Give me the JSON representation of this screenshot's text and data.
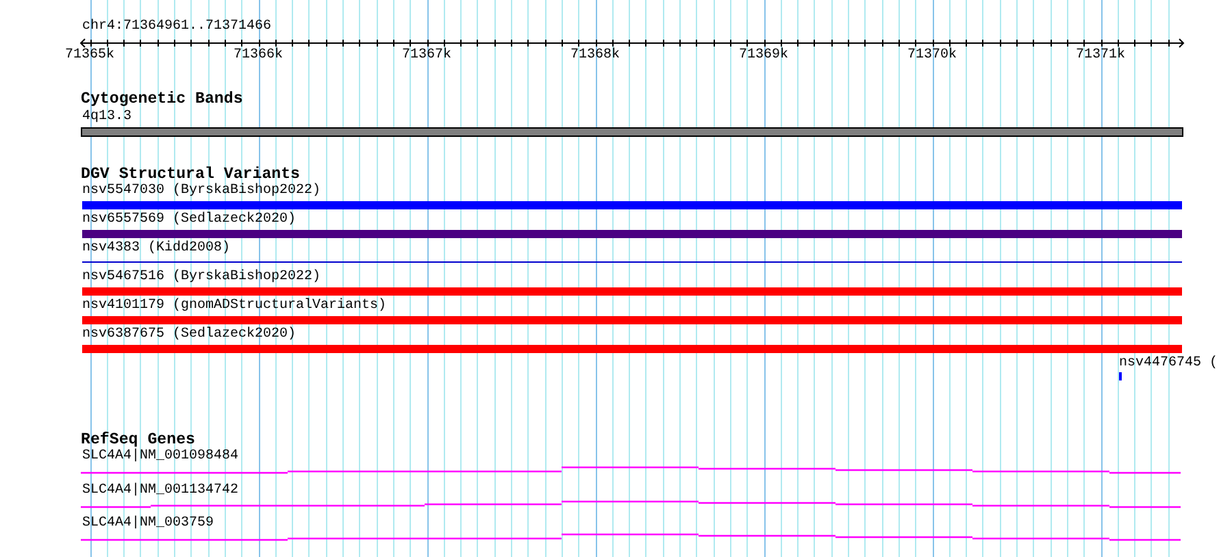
{
  "location": "chr4:71364961..71371466",
  "ruler": {
    "ticks": [
      "71365k",
      "71366k",
      "71367k",
      "71368k",
      "71369k",
      "71370k",
      "71371k"
    ]
  },
  "tracks": [
    {
      "kind": "cyto",
      "title": "Cytogenetic Bands",
      "features": [
        {
          "label": "4q13.3",
          "kind": "band"
        }
      ]
    },
    {
      "kind": "variants",
      "title": "DGV Structural Variants",
      "features": [
        {
          "label": "nsv5547030 (ByrskaBishop2022)",
          "kind": "bar",
          "color": "#0000ff"
        },
        {
          "label": "nsv6557569 (Sedlazeck2020)",
          "kind": "bar",
          "color": "#4b0082"
        },
        {
          "label": "nsv4383 (Kidd2008)",
          "kind": "line",
          "color": "#0000cd"
        },
        {
          "label": "nsv5467516 (ByrskaBishop2022)",
          "kind": "bar",
          "color": "#ff0000"
        },
        {
          "label": "nsv4101179 (gnomADStructuralVariants)",
          "kind": "bar",
          "color": "#ff0000"
        },
        {
          "label": "nsv6387675 (Sedlazeck2020)",
          "kind": "bar",
          "color": "#ff0000"
        },
        {
          "label": "nsv4476745 (",
          "kind": "tick",
          "color": "#0000ff"
        }
      ]
    },
    {
      "kind": "genes",
      "title": "RefSeq Genes",
      "features": [
        {
          "label": "SLC4A4|NM_001098484",
          "kind": "gene"
        },
        {
          "label": "SLC4A4|NM_001134742",
          "kind": "gene"
        },
        {
          "label": "SLC4A4|NM_003759",
          "kind": "gene"
        }
      ]
    }
  ]
}
